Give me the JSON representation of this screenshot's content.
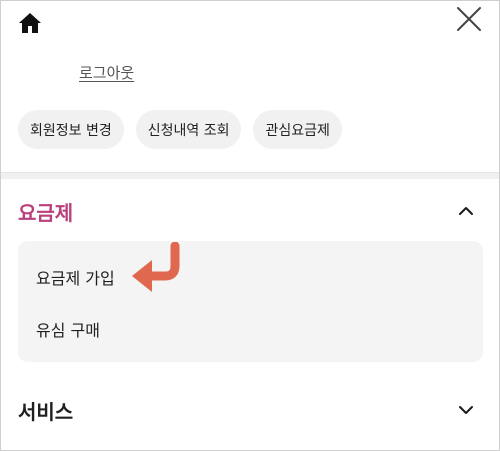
{
  "header": {
    "home_icon": "home-icon",
    "close_icon": "close-icon",
    "logout_label": "로그아웃"
  },
  "quick_links": [
    {
      "label": "회원정보 변경"
    },
    {
      "label": "신청내역 조회"
    },
    {
      "label": "관심요금제"
    }
  ],
  "menu": {
    "plan": {
      "title": "요금제",
      "expanded": true,
      "items": [
        {
          "label": "요금제 가입"
        },
        {
          "label": "유심 구매"
        }
      ]
    },
    "service": {
      "title": "서비스",
      "expanded": false
    }
  },
  "colors": {
    "accent": "#b93f7d",
    "annotation_arrow": "#e0684e",
    "chip_bg": "#f1f1f1",
    "submenu_bg": "#f4f4f4"
  }
}
